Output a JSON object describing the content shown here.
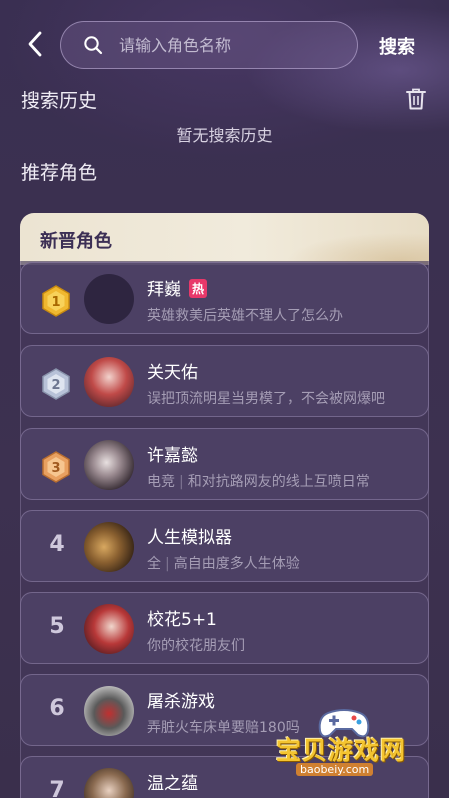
{
  "header": {
    "search_placeholder": "请输入角色名称",
    "search_button": "搜索"
  },
  "history": {
    "title": "搜索历史",
    "empty_text": "暂无搜索历史"
  },
  "recommend": {
    "title": "推荐角色",
    "panel_title": "新晋角色"
  },
  "items": [
    {
      "rank": "1",
      "name": "拜巍",
      "hot": "热",
      "desc": "英雄救美后英雄不理人了怎么办"
    },
    {
      "rank": "2",
      "name": "关天佑",
      "desc": "误把顶流明星当男模了，不会被网爆吧"
    },
    {
      "rank": "3",
      "name": "许嘉懿",
      "desc_a": "电竞",
      "desc_b": "和对抗路网友的线上互喷日常"
    },
    {
      "rank": "4",
      "name": "人生模拟器",
      "desc_a": "全",
      "desc_b": "高自由度多人生体验"
    },
    {
      "rank": "5",
      "name": "校花5+1",
      "desc": "你的校花朋友们"
    },
    {
      "rank": "6",
      "name": "屠杀游戏",
      "desc": "弄脏火车床单要赔180吗"
    },
    {
      "rank": "7",
      "name": "温之蕴",
      "desc": ""
    }
  ],
  "watermark": {
    "text": "宝贝游戏网",
    "url": "baobeiy.com"
  },
  "colors": {
    "background": "#3b3050",
    "panel_header": "#ece4d2",
    "hot_tag": "#e8386a",
    "gold_badge": "#f0b830",
    "silver_badge": "#b8c2d8",
    "bronze_badge": "#e8a060"
  }
}
